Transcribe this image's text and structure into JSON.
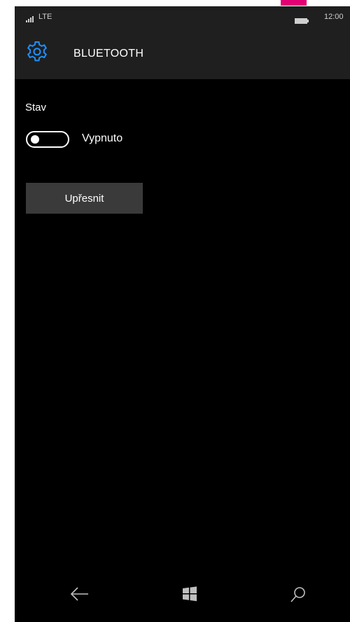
{
  "status_bar": {
    "network": "LTE",
    "time": "12:00",
    "signal_icon": "signal-icon",
    "battery_icon": "battery-icon"
  },
  "header": {
    "icon": "gear-icon",
    "title": "BLUETOOTH",
    "icon_color": "#1e90ff"
  },
  "bluetooth": {
    "state_label": "Stav",
    "toggle_state": "Vypnuto",
    "toggle_on": false
  },
  "actions": {
    "advanced_label": "Upřesnit"
  },
  "nav_bar": {
    "back_icon": "back-arrow-icon",
    "start_icon": "windows-icon",
    "search_icon": "search-icon"
  },
  "colors": {
    "background": "#000000",
    "bar": "#1f1f1f",
    "accent": "#1e90ff",
    "brand": "#e20074",
    "button": "#3a3a3a"
  }
}
